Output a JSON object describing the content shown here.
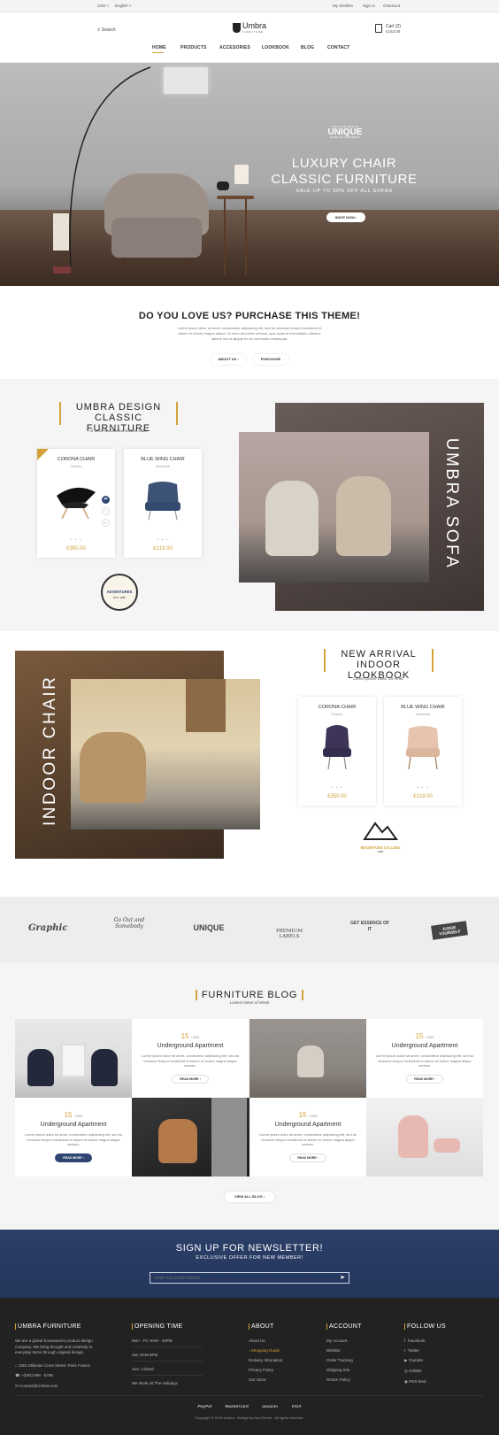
{
  "topbar": {
    "currency": "USD",
    "language": "English",
    "wishlist": "My Wishlist",
    "signin": "Sign In",
    "checkout": "Checkout"
  },
  "header": {
    "search": "Search",
    "logo": "Umbra",
    "logo_sub": "FURNITURE",
    "cart": "Cart (2)",
    "cart_total": "£163.00"
  },
  "nav": [
    "HOME",
    "PRODUCTS",
    "ACCESORIES",
    "LOOKBOOK",
    "BLOG",
    "CONTACT"
  ],
  "hero": {
    "badge": "UNIQUE",
    "badge_top": "CREATIVE DESIGN",
    "badge_bottom": "ESSENTIAL ORNAMENTS",
    "title1": "LUXURY CHAIR",
    "title2": "CLASSIC FURNITURE",
    "subtitle": "SALE UP TO 50% OFF ALL SOFAS",
    "button": "SHOP NOW ›"
  },
  "promo": {
    "title": "DO YOU LOVE US? PURCHASE THIS THEME!",
    "text": "Lorem ipsum dolor sit amet, consectetur adipiscing elit, sed do eiusmod tempor incididunt ut labore et dolore magna aliqua. Ut enim ad minim veniam, quis nostrud exercitation ullamco laboris nisi ut aliquip ex ea commodo consequat.",
    "btn1": "ABOUT US ›",
    "btn2": "PURCHASE"
  },
  "design": {
    "title1": "UMBRA DESIGN",
    "title2": "CLASSIC FURNITURE",
    "subtitle": "At Vero Accusamus Etiusto Odio.",
    "badge": "ADVENTURES",
    "badge_sub": "EST. 1986",
    "vertical": "UMBRA SOFA"
  },
  "products1": [
    {
      "name": "CORONA CHAIR",
      "cat": "Classic",
      "price": "£350.00"
    },
    {
      "name": "BLUE WING CHAIR",
      "cat": "Armchair",
      "price": "£219.00"
    }
  ],
  "lookbook": {
    "title1": "NEW ARRIVAL",
    "title2": "INDOOR LOOKBOOK",
    "subtitle": "Lorem Ipsum Dolor Sit Amet.",
    "vertical": "INDOOR CHAIR",
    "badge": "MOUNTAINS CALLING",
    "badge_sub": "1986"
  },
  "products2": [
    {
      "name": "CORONA CHAIR",
      "cat": "Classic",
      "price": "£350.00"
    },
    {
      "name": "BLUE WING CHAIR",
      "cat": "Armchair",
      "price": "£219.00"
    }
  ],
  "brands": [
    "Graphic",
    "Go Out and Somebody",
    "UNIQUE",
    "PREMIUM LABELS",
    "GET ESSENCE OF IT",
    "JUDGE YOURSELF"
  ],
  "blog": {
    "title": "FURNITURE BLOG",
    "subtitle": "Lastest News of Week",
    "view_all": "VIEW ALL BLOG ›",
    "posts": [
      {
        "day": "15",
        "month": "/ 2016",
        "title": "Underground Apartment",
        "text": "Lorem ipsum dolor sit amet, consectetur adipiscing elit, sed do eiusmod tempor incididunt ut labore et dolore magna aliqua veniam.",
        "btn": "READ MORE ›"
      },
      {
        "day": "15",
        "month": "/ 2016",
        "title": "Underground Apartment",
        "text": "Lorem ipsum dolor sit amet, consectetur adipiscing elit, sed do eiusmod tempor incididunt ut labore et dolore magna aliqua veniam.",
        "btn": "READ MORE ›"
      },
      {
        "day": "15",
        "month": "/ 2016",
        "title": "Underground Apartment",
        "text": "Lorem ipsum dolor sit amet, consectetur adipiscing elit, sed do eiusmod tempor incididunt ut labore et dolore magna aliqua veniam.",
        "btn": "READ MORE ›"
      },
      {
        "day": "15",
        "month": "/ 2016",
        "title": "Underground Apartment",
        "text": "Lorem ipsum dolor sit amet, consectetur adipiscing elit, sed do eiusmod tempor incididunt ut labore et dolore magna aliqua veniam.",
        "btn": "READ MORE ›"
      }
    ]
  },
  "newsletter": {
    "title": "SIGN UP FOR NEWSLETTER!",
    "subtitle": "EXCLUSIVE OFFER FOR NEW MEMBER!",
    "placeholder": "Enter Your Email Address"
  },
  "footer": {
    "about_title": "UMBRA FURNITURE",
    "about_text": "We are a global housewares product design company. We bring thought and creativity to everyday items through original design.",
    "address": "1001 Milasian Crest Street, Paris France",
    "phone": "+(084) 888 - 6789",
    "email": "Contact@Umbra.com",
    "hours_title": "OPENING TIME",
    "hours": [
      "Mon - Fri: 8AM - 10PM",
      "Sat: 9AM-8PM",
      "Sun: Closed",
      "We Work All The Holidays"
    ],
    "about2_title": "ABOUT",
    "about_links": [
      "About Us",
      "Shopping Guide",
      "Delivery Infomation",
      "Privacy Policy",
      "Our Store"
    ],
    "account_title": "ACCOUNT",
    "account_links": [
      "My Account",
      "Wishlist",
      "Order Tracking",
      "Shipping Info",
      "Return Policy"
    ],
    "follow_title": "FOLLOW US",
    "follow_links": [
      "Facebook",
      "Twitter",
      "Youtube",
      "Dribble",
      "RSS feed"
    ],
    "payments": [
      "PayPal",
      "MasterCard",
      "amazon",
      "VISA"
    ],
    "copyright": "Copyright © 2015 Umbra - Design by NooTheme - All rights reserved."
  },
  "colors": {
    "accent": "#d4a23a",
    "navy": "#2f4673",
    "dark": "#222222"
  }
}
